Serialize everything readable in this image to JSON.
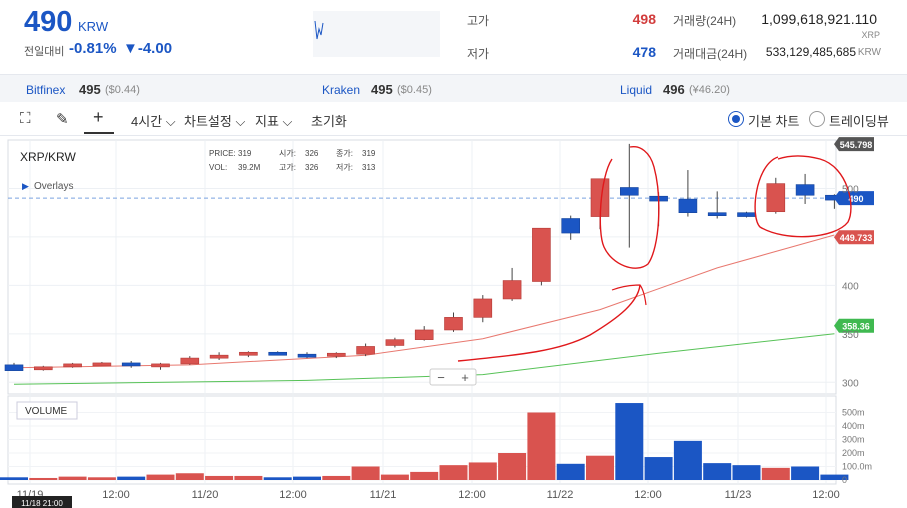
{
  "ticker": {
    "price": "490",
    "unit": "KRW",
    "change_label": "전일대비",
    "change_pct": "-0.81%",
    "change_abs": "▼-4.00"
  },
  "stats": {
    "high_label": "고가",
    "high_value": "498",
    "low_label": "저가",
    "low_value": "478",
    "volume_label": "거래량(24H)",
    "volume_value": "1,099,618,921.110",
    "volume_unit": "XRP",
    "amount_label": "거래대금(24H)",
    "amount_value": "533,129,485,685",
    "amount_unit": "KRW",
    "high_color": "#d23c3c",
    "low_color": "#1b56c4"
  },
  "exchanges": [
    {
      "name": "Bitfinex",
      "value": "495",
      "sub": "($0.44)"
    },
    {
      "name": "Kraken",
      "value": "495",
      "sub": "($0.45)"
    },
    {
      "name": "Liquid",
      "value": "496",
      "sub": "(¥46.20)"
    }
  ],
  "toolbar": {
    "interval": "4시간",
    "chart_settings": "차트설정",
    "indicators": "지표",
    "reset": "초기화",
    "basic_chart": "기본 차트",
    "trading_view": "트레이딩뷰"
  },
  "chart_data": {
    "type": "candlestick",
    "title": "XRP/KRW",
    "overlays_label": "Overlays",
    "volume_label": "VOLUME",
    "info": {
      "price_label": "PRICE:",
      "price": "319",
      "open_label": "시가:",
      "open": "326",
      "close_label": "종가:",
      "close": "319",
      "vol_label": "VOL:",
      "vol": "39.2M",
      "high_label": "고가:",
      "high": "326",
      "low_label": "저가:",
      "low": "313"
    },
    "ylim": [
      290,
      550
    ],
    "y_ticks": [
      300,
      350,
      400,
      450,
      500
    ],
    "y_tick_labels": [
      "300",
      "350",
      "400",
      "",
      "500"
    ],
    "vol_ylim": [
      0,
      600
    ],
    "vol_ticks": [
      0,
      100,
      200,
      300,
      400,
      500
    ],
    "vol_tick_labels": [
      "0",
      "100.0m",
      "200m",
      "300m",
      "400m",
      "500m"
    ],
    "x_labels": [
      "11/19",
      "12:00",
      "11/20",
      "12:00",
      "11/21",
      "12:00",
      "11/22",
      "12:00",
      "11/23",
      "12:00"
    ],
    "x_first_tooltip": "11/18 21:00",
    "candles": [
      {
        "o": 318,
        "h": 320,
        "l": 314,
        "c": 312,
        "v": 20
      },
      {
        "o": 314,
        "h": 317,
        "l": 312,
        "c": 316,
        "v": 15
      },
      {
        "o": 316,
        "h": 320,
        "l": 315,
        "c": 319,
        "v": 25
      },
      {
        "o": 319,
        "h": 321,
        "l": 317,
        "c": 320,
        "v": 20
      },
      {
        "o": 320,
        "h": 322,
        "l": 315,
        "c": 317,
        "v": 25
      },
      {
        "o": 317,
        "h": 320,
        "l": 313,
        "c": 319,
        "v": 40
      },
      {
        "o": 319,
        "h": 327,
        "l": 318,
        "c": 325,
        "v": 50
      },
      {
        "o": 325,
        "h": 331,
        "l": 323,
        "c": 328,
        "v": 30
      },
      {
        "o": 328,
        "h": 332,
        "l": 326,
        "c": 331,
        "v": 30
      },
      {
        "o": 331,
        "h": 332,
        "l": 328,
        "c": 329,
        "v": 20
      },
      {
        "o": 329,
        "h": 331,
        "l": 325,
        "c": 327,
        "v": 25
      },
      {
        "o": 327,
        "h": 331,
        "l": 325,
        "c": 330,
        "v": 30
      },
      {
        "o": 329,
        "h": 340,
        "l": 327,
        "c": 337,
        "v": 100
      },
      {
        "o": 338,
        "h": 346,
        "l": 336,
        "c": 344,
        "v": 40
      },
      {
        "o": 344,
        "h": 358,
        "l": 343,
        "c": 354,
        "v": 60
      },
      {
        "o": 354,
        "h": 372,
        "l": 352,
        "c": 367,
        "v": 110
      },
      {
        "o": 367,
        "h": 390,
        "l": 362,
        "c": 386,
        "v": 130
      },
      {
        "o": 386,
        "h": 418,
        "l": 384,
        "c": 405,
        "v": 200
      },
      {
        "o": 404,
        "h": 437,
        "l": 400,
        "c": 459,
        "v": 500
      },
      {
        "o": 469,
        "h": 472,
        "l": 447,
        "c": 454,
        "v": 120
      },
      {
        "o": 471,
        "h": 483,
        "l": 458,
        "c": 510,
        "v": 180
      },
      {
        "o": 501,
        "h": 546,
        "l": 439,
        "c": 493,
        "v": 570
      },
      {
        "o": 492,
        "h": 496,
        "l": 461,
        "c": 487,
        "v": 170
      },
      {
        "o": 489,
        "h": 519,
        "l": 471,
        "c": 475,
        "v": 290
      },
      {
        "o": 475,
        "h": 497,
        "l": 469,
        "c": 472,
        "v": 125
      },
      {
        "o": 475,
        "h": 476,
        "l": 470,
        "c": 471,
        "v": 110
      },
      {
        "o": 476,
        "h": 511,
        "l": 474,
        "c": 505,
        "v": 90
      },
      {
        "o": 504,
        "h": 515,
        "l": 484,
        "c": 493,
        "v": 100
      },
      {
        "o": 493,
        "h": 494,
        "l": 479,
        "c": 488,
        "v": 40
      }
    ],
    "ma_red": [
      {
        "x": 0,
        "y": 315
      },
      {
        "x": 6,
        "y": 318
      },
      {
        "x": 12,
        "y": 328
      },
      {
        "x": 16,
        "y": 345
      },
      {
        "x": 20,
        "y": 375
      },
      {
        "x": 24,
        "y": 418
      },
      {
        "x": 28,
        "y": 452
      }
    ],
    "ma_green": [
      {
        "x": 0,
        "y": 298
      },
      {
        "x": 10,
        "y": 302
      },
      {
        "x": 16,
        "y": 308
      },
      {
        "x": 22,
        "y": 330
      },
      {
        "x": 28,
        "y": 350
      }
    ],
    "price_badges": [
      {
        "label": "545.798",
        "value": 545.8,
        "color": "#555555"
      },
      {
        "label": "490",
        "value": 490,
        "color": "#1b56c4"
      },
      {
        "label": "449.733",
        "value": 449.7,
        "color": "#d9534f"
      },
      {
        "label": "358.36",
        "value": 358.4,
        "color": "#3fb950"
      }
    ],
    "colors": {
      "up": "#d9534f",
      "down": "#1b56c4",
      "ma_red": "#e8786f",
      "ma_green": "#57c257"
    }
  }
}
